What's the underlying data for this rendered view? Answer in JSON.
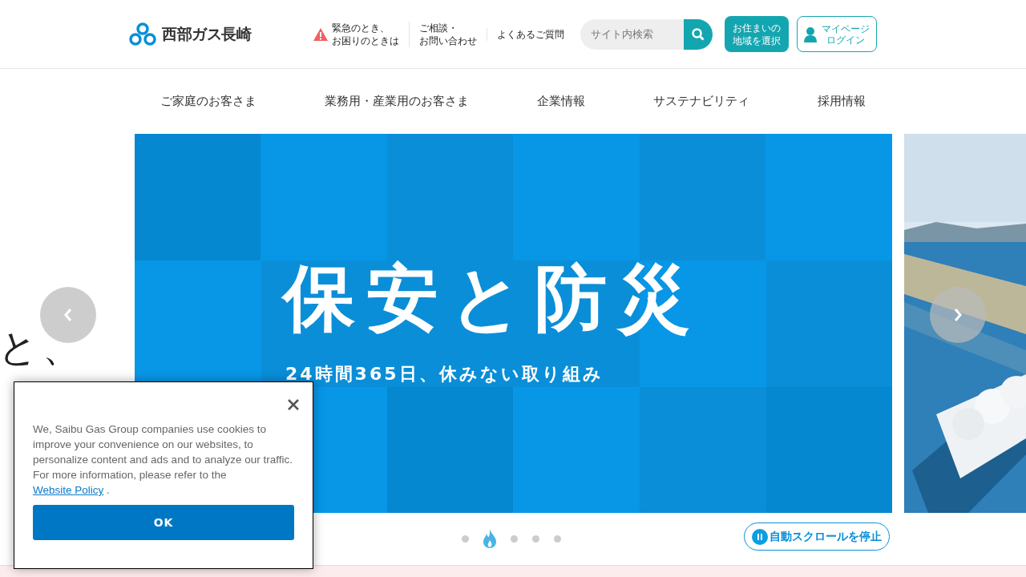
{
  "header": {
    "logo_text": "西部ガス長崎",
    "links": [
      {
        "kind": "alert",
        "lines": [
          "緊急のとき、",
          "お困りのときは"
        ]
      },
      {
        "kind": "plain",
        "lines": [
          "ご相談・",
          "お問い合わせ"
        ]
      },
      {
        "kind": "plain",
        "lines": [
          "よくあるご質問"
        ]
      }
    ],
    "search": {
      "placeholder": "サイト内検索"
    },
    "region_button": [
      "お住まいの",
      "地域を選択"
    ],
    "mypage_button": [
      "マイページ",
      "ログイン"
    ]
  },
  "nav": [
    "ご家庭のお客さま",
    "業務用・産業用のお客さま",
    "企業情報",
    "サステナビリティ",
    "採用情報"
  ],
  "slider": {
    "prev_slide_text": "と、",
    "banner": {
      "title": "保安と防災",
      "subtitle": "24時間365日、休みない取り組み"
    },
    "dots": [
      {
        "selected": false
      },
      {
        "selected": true
      },
      {
        "selected": false
      },
      {
        "selected": false
      },
      {
        "selected": false
      }
    ],
    "pause_button": "自動スクロールを停止"
  },
  "cookie_dialog": {
    "text": "We, Saibu Gas Group companies use cookies to improve your convenience on our websites, to personalize content and ads and to analyze our traffic. For more information, please refer to the",
    "link": "Website Policy",
    "after_link": ".",
    "ok": "OK"
  }
}
